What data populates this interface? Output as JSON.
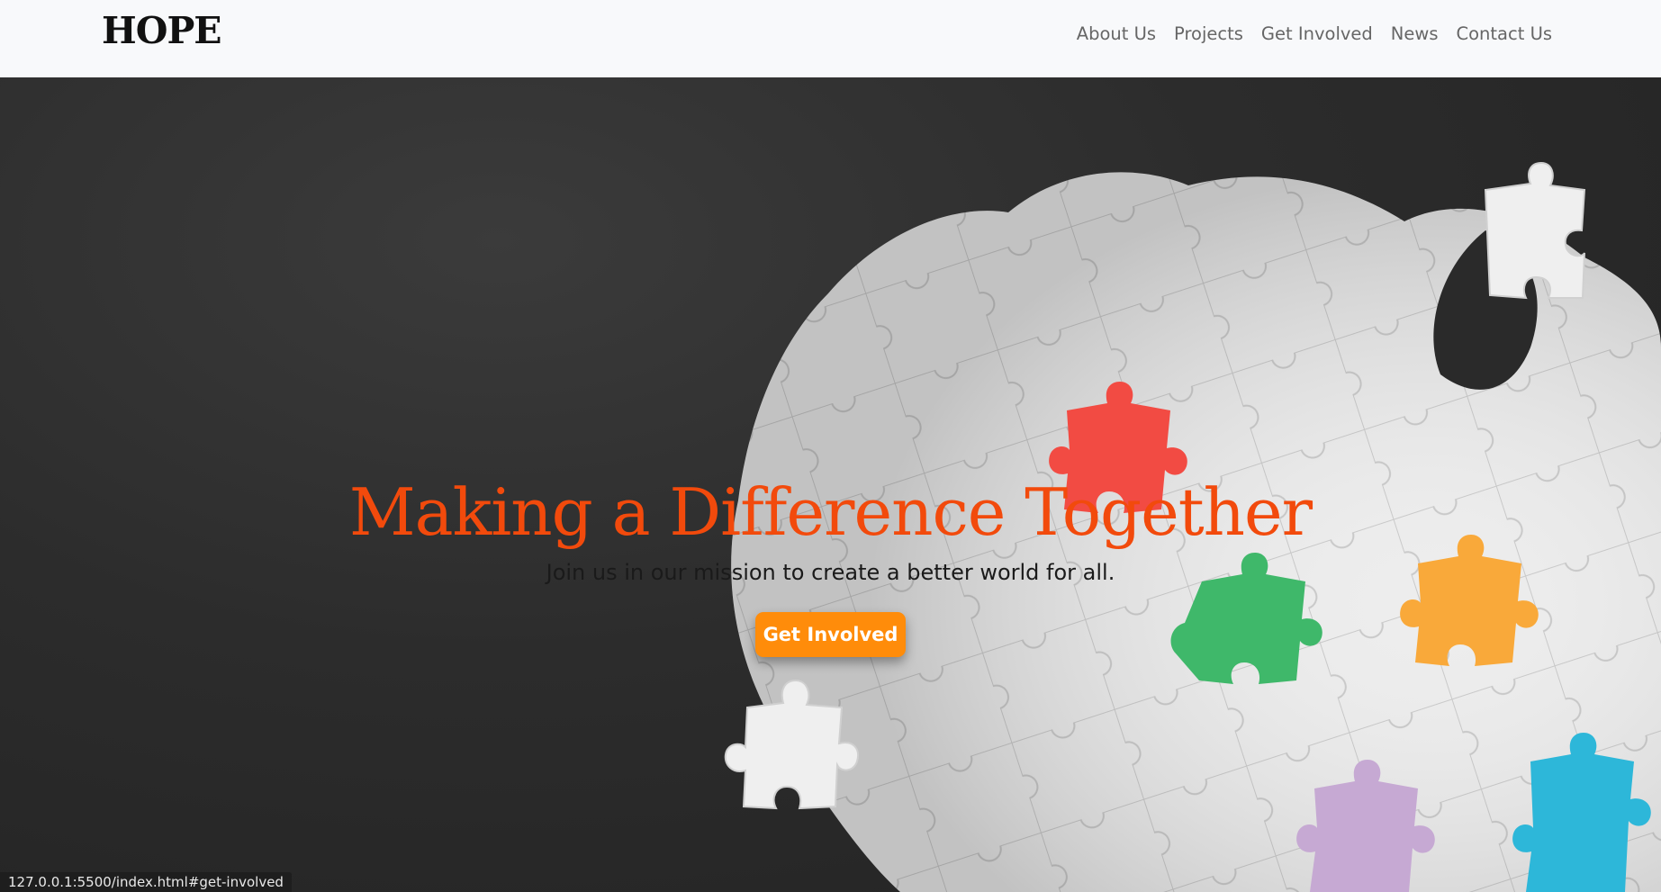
{
  "navbar": {
    "brand": "HOPE",
    "links": [
      "About Us",
      "Projects",
      "Get Involved",
      "News",
      "Contact Us"
    ]
  },
  "hero": {
    "title": "Making a Difference Together",
    "subtitle": "Join us in our mission to create a better world for all.",
    "cta_label": "Get Involved",
    "image": "puzzle-pieces-image"
  },
  "status_bar": {
    "url": "127.0.0.1:5500/index.html#get-involved"
  },
  "colors": {
    "nav_bg": "#f8f9fb",
    "title_accent": "#f24a0c",
    "cta_bg": "#ff8c0a",
    "puzzle_red": "#f24b43",
    "puzzle_green": "#3fb86a",
    "puzzle_orange": "#f9a93a",
    "puzzle_purple": "#c6a9d3",
    "puzzle_cyan": "#2db7d9"
  }
}
